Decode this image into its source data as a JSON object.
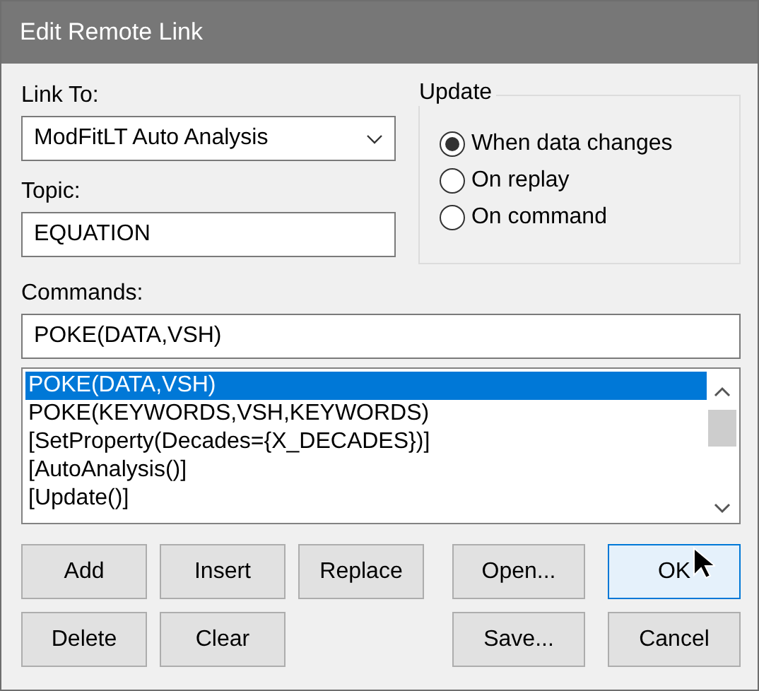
{
  "window": {
    "title": "Edit Remote Link"
  },
  "link_to": {
    "label": "Link To:",
    "value": "ModFitLT Auto Analysis"
  },
  "topic": {
    "label": "Topic:",
    "value": "EQUATION"
  },
  "update": {
    "title": "Update",
    "options": [
      {
        "label": "When data changes",
        "selected": true
      },
      {
        "label": "On replay",
        "selected": false
      },
      {
        "label": "On command",
        "selected": false
      }
    ]
  },
  "commands": {
    "label": "Commands:",
    "value": "POKE(DATA,VSH)",
    "items": [
      {
        "text": "POKE(DATA,VSH)",
        "selected": true
      },
      {
        "text": "POKE(KEYWORDS,VSH,KEYWORDS)",
        "selected": false
      },
      {
        "text": "[SetProperty(Decades={X_DECADES})]",
        "selected": false
      },
      {
        "text": "[AutoAnalysis()]",
        "selected": false
      },
      {
        "text": "[Update()]",
        "selected": false
      }
    ]
  },
  "edit_buttons": [
    [
      {
        "label": "Add",
        "hovered": false
      },
      {
        "label": "Insert",
        "hovered": false
      },
      {
        "label": "Replace",
        "hovered": false
      }
    ],
    [
      {
        "label": "Delete",
        "hovered": false
      },
      {
        "label": "Clear",
        "hovered": false
      }
    ]
  ],
  "file_buttons": [
    [
      {
        "label": "Open...",
        "hovered": false
      },
      {
        "label": "OK",
        "hovered": true
      }
    ],
    [
      {
        "label": "Save...",
        "hovered": false
      },
      {
        "label": "Cancel",
        "hovered": false
      }
    ]
  ]
}
